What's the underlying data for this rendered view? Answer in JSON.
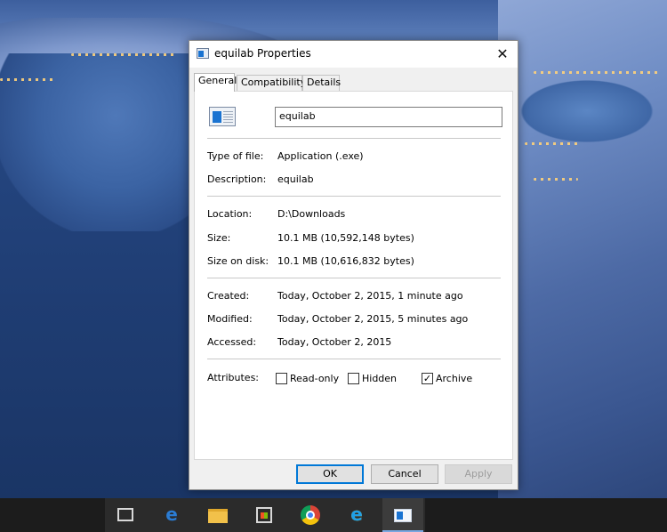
{
  "window": {
    "title": "equilab Properties",
    "close_glyph": "✕"
  },
  "tabs": [
    {
      "label": "General",
      "active": true
    },
    {
      "label": "Compatibility",
      "active": false
    },
    {
      "label": "Details",
      "active": false
    }
  ],
  "general": {
    "filename": "equilab",
    "type_label": "Type of file:",
    "type_value": "Application (.exe)",
    "description_label": "Description:",
    "description_value": "equilab",
    "location_label": "Location:",
    "location_value": "D:\\Downloads",
    "size_label": "Size:",
    "size_value": "10.1 MB (10,592,148 bytes)",
    "size_on_disk_label": "Size on disk:",
    "size_on_disk_value": "10.1 MB (10,616,832 bytes)",
    "created_label": "Created:",
    "created_value": "Today, October 2, 2015, 1 minute ago",
    "modified_label": "Modified:",
    "modified_value": "Today, October 2, 2015, 5 minutes ago",
    "accessed_label": "Accessed:",
    "accessed_value": "Today, October 2, 2015",
    "attributes_label": "Attributes:",
    "attributes": {
      "readonly": {
        "label": "Read-only",
        "checked": false
      },
      "hidden": {
        "label": "Hidden",
        "checked": false
      },
      "archive": {
        "label": "Archive",
        "checked": true,
        "mark": "✓"
      }
    }
  },
  "buttons": {
    "ok": "OK",
    "cancel": "Cancel",
    "apply": "Apply"
  },
  "taskbar": {
    "icons": [
      "task-view-icon",
      "edge-icon",
      "file-explorer-icon",
      "store-icon",
      "chrome-icon",
      "internet-explorer-icon",
      "equilab-app-icon"
    ],
    "edge_glyph": "e",
    "ie_glyph": "e"
  },
  "colors": {
    "accent": "#0078d7",
    "taskbar": "#1c1c1c",
    "edge_blue": "#2b7cd3",
    "ie_blue": "#1ea0e8",
    "ie_ring": "#f3c318"
  }
}
